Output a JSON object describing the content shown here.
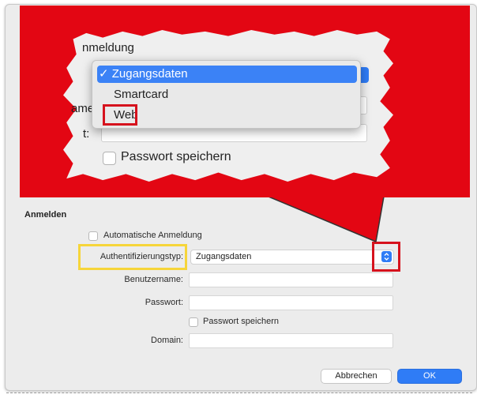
{
  "dialog": {
    "section_title": "Anmelden",
    "auto_login_label": "Automatische Anmeldung",
    "auth_type_label": "Authentifizierungstyp:",
    "auth_type_value": "Zugangsdaten",
    "username_label": "Benutzername:",
    "username_value": "",
    "password_label": "Passwort:",
    "password_value": "",
    "save_password_label": "Passwort speichern",
    "domain_label": "Domain:",
    "domain_value": "",
    "cancel_label": "Abbrechen",
    "ok_label": "OK"
  },
  "callout": {
    "title_fragment": "nmeldung",
    "user_label_fragment": "ame",
    "password_label_fragment": "t:",
    "save_password_label": "Passwort speichern",
    "menu_items": [
      {
        "label": "✓ Zugangsdaten",
        "selected": true
      },
      {
        "label": "Smartcard",
        "selected": false
      },
      {
        "label": "Web",
        "selected": false
      }
    ]
  },
  "colors": {
    "accent_blue": "#2f7cf6",
    "callout_red": "#e30613",
    "highlight_red": "#d6121d",
    "highlight_yellow": "#f6d53a"
  }
}
